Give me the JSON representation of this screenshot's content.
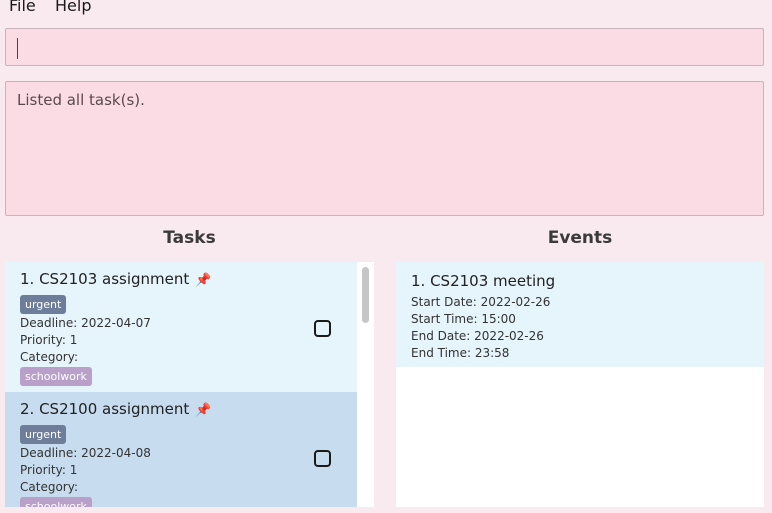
{
  "menu": {
    "file": "File",
    "help": "Help"
  },
  "command": {
    "value": ""
  },
  "result": {
    "text": "Listed all task(s)."
  },
  "tasks_panel": {
    "title": "Tasks",
    "items": [
      {
        "title": "1.  CS2103 assignment",
        "tag": "urgent",
        "deadline": "Deadline: 2022-04-07",
        "priority": "Priority: 1",
        "category_label": "Category:",
        "category": "schoolwork",
        "checked": false
      },
      {
        "title": "2.  CS2100 assignment",
        "tag": "urgent",
        "deadline": "Deadline: 2022-04-08",
        "priority": "Priority: 1",
        "category_label": "Category:",
        "category": "schoolwork",
        "checked": false
      }
    ]
  },
  "events_panel": {
    "title": "Events",
    "items": [
      {
        "title": "1.  CS2103 meeting",
        "start_date": "Start Date: 2022-02-26",
        "start_time": "Start Time: 15:00",
        "end_date": "End Date: 2022-02-26",
        "end_time": "End Time: 23:58"
      }
    ]
  },
  "icons": {
    "pin": "pushpin-icon",
    "checkbox": "checkbox-icon"
  },
  "colors": {
    "background": "#f9eaf0",
    "input_bg": "#fbdce5",
    "task_card_1": "#e6f4fc",
    "task_card_2_selected": "#c7dcef",
    "tag_urgent": "#6e7e9a",
    "tag_category": "#b8a0c8"
  }
}
